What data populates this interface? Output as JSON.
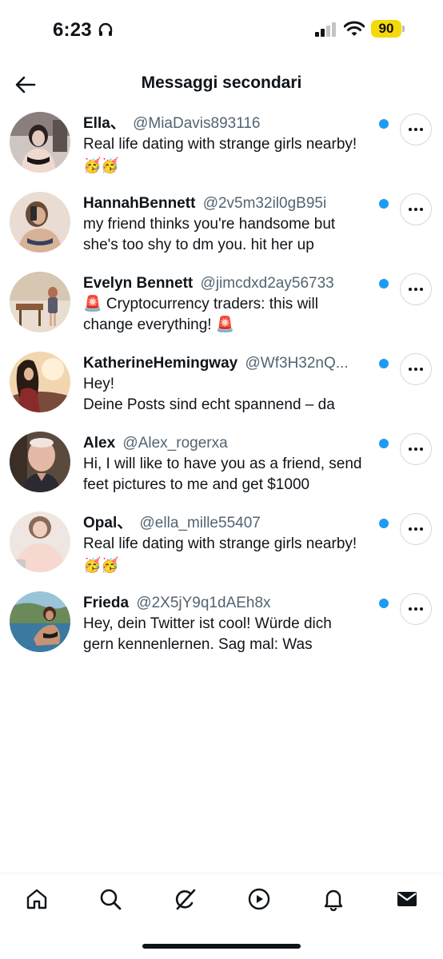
{
  "status_bar": {
    "time": "6:23",
    "battery": "90",
    "icons": [
      "headphones-icon",
      "signal-icon",
      "wifi-icon",
      "battery-icon"
    ]
  },
  "header": {
    "title": "Messaggi secondari",
    "back_icon": "arrow-left-icon"
  },
  "messages": [
    {
      "name": "Ella、",
      "handle": "@MiaDavis893116",
      "lines": [
        "Real life dating with strange girls nearby!",
        "🥳🥳"
      ],
      "unread": true,
      "avatar_color": "#5a4a4a"
    },
    {
      "name": "HannahBennett",
      "handle": "@2v5m32il0gB95i",
      "lines": [
        "my friend thinks you're handsome but",
        "she's too shy to dm you. hit her up"
      ],
      "unread": true,
      "avatar_color": "#c49a7a"
    },
    {
      "name": "Evelyn Bennett",
      "handle": "@jimcdxd2ay56733",
      "lines": [
        "🚨 Cryptocurrency traders: this will",
        "change everything! 🚨"
      ],
      "unread": true,
      "avatar_color": "#b08a64"
    },
    {
      "name": "KatherineHemingway",
      "handle": "@Wf3H32nQ...",
      "lines": [
        "Hey!",
        "Deine Posts sind echt spannend – da"
      ],
      "unread": true,
      "avatar_color": "#8a5a3a"
    },
    {
      "name": "Alex",
      "handle": "@Alex_rogerxa",
      "lines": [
        "Hi, I will like to have you as a friend, send",
        "feet pictures to me and get $1000"
      ],
      "unread": true,
      "avatar_color": "#7a6654"
    },
    {
      "name": "Opal、",
      "handle": "@ella_mille55407",
      "lines": [
        "Real life dating with strange girls nearby!",
        "🥳🥳"
      ],
      "unread": true,
      "avatar_color": "#e8c8c0"
    },
    {
      "name": "Frieda",
      "handle": "@2X5jY9q1dAEh8x",
      "lines": [
        "Hey, dein Twitter ist cool! Würde dich",
        "gern kennenlernen. Sag mal: Was"
      ],
      "unread": true,
      "avatar_color": "#5a8aa0"
    }
  ],
  "bottom_nav": {
    "items": [
      "home-icon",
      "search-icon",
      "grok-icon",
      "video-icon",
      "notifications-icon",
      "messages-icon"
    ],
    "active": "messages-icon"
  },
  "colors": {
    "accent": "#1d9bf0",
    "text_primary": "#0f1419",
    "text_secondary": "#536471",
    "battery": "#f5d90a"
  }
}
